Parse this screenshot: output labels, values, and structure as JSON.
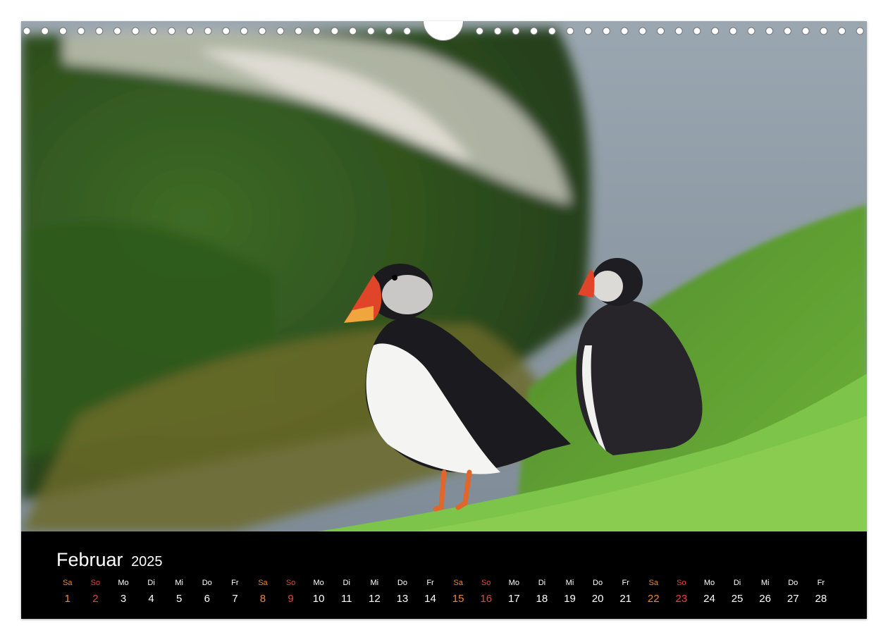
{
  "calendar": {
    "month": "Februar",
    "year": "2025",
    "days": [
      {
        "weekday": "Sa",
        "day": "1",
        "type": "sat"
      },
      {
        "weekday": "So",
        "day": "2",
        "type": "sun"
      },
      {
        "weekday": "Mo",
        "day": "3",
        "type": "weekday"
      },
      {
        "weekday": "Di",
        "day": "4",
        "type": "weekday"
      },
      {
        "weekday": "Mi",
        "day": "5",
        "type": "weekday"
      },
      {
        "weekday": "Do",
        "day": "6",
        "type": "weekday"
      },
      {
        "weekday": "Fr",
        "day": "7",
        "type": "weekday"
      },
      {
        "weekday": "Sa",
        "day": "8",
        "type": "sat"
      },
      {
        "weekday": "So",
        "day": "9",
        "type": "sun"
      },
      {
        "weekday": "Mo",
        "day": "10",
        "type": "weekday"
      },
      {
        "weekday": "Di",
        "day": "11",
        "type": "weekday"
      },
      {
        "weekday": "Mi",
        "day": "12",
        "type": "weekday"
      },
      {
        "weekday": "Do",
        "day": "13",
        "type": "weekday"
      },
      {
        "weekday": "Fr",
        "day": "14",
        "type": "weekday"
      },
      {
        "weekday": "Sa",
        "day": "15",
        "type": "sat"
      },
      {
        "weekday": "So",
        "day": "16",
        "type": "sun"
      },
      {
        "weekday": "Mo",
        "day": "17",
        "type": "weekday"
      },
      {
        "weekday": "Di",
        "day": "18",
        "type": "weekday"
      },
      {
        "weekday": "Mi",
        "day": "19",
        "type": "weekday"
      },
      {
        "weekday": "Do",
        "day": "20",
        "type": "weekday"
      },
      {
        "weekday": "Fr",
        "day": "21",
        "type": "weekday"
      },
      {
        "weekday": "Sa",
        "day": "22",
        "type": "sat"
      },
      {
        "weekday": "So",
        "day": "23",
        "type": "sun"
      },
      {
        "weekday": "Mo",
        "day": "24",
        "type": "weekday"
      },
      {
        "weekday": "Di",
        "day": "25",
        "type": "weekday"
      },
      {
        "weekday": "Mi",
        "day": "26",
        "type": "weekday"
      },
      {
        "weekday": "Do",
        "day": "27",
        "type": "weekday"
      },
      {
        "weekday": "Fr",
        "day": "28",
        "type": "weekday"
      }
    ]
  },
  "colors": {
    "band": "#000000",
    "weekday_text": "#ffffff",
    "saturday": "#e8893a",
    "sunday": "#e0473e"
  },
  "photo": {
    "subject_icons": [
      "puffin-front",
      "puffin-back",
      "grass-slope",
      "sea",
      "cliff-with-seabirds"
    ]
  }
}
